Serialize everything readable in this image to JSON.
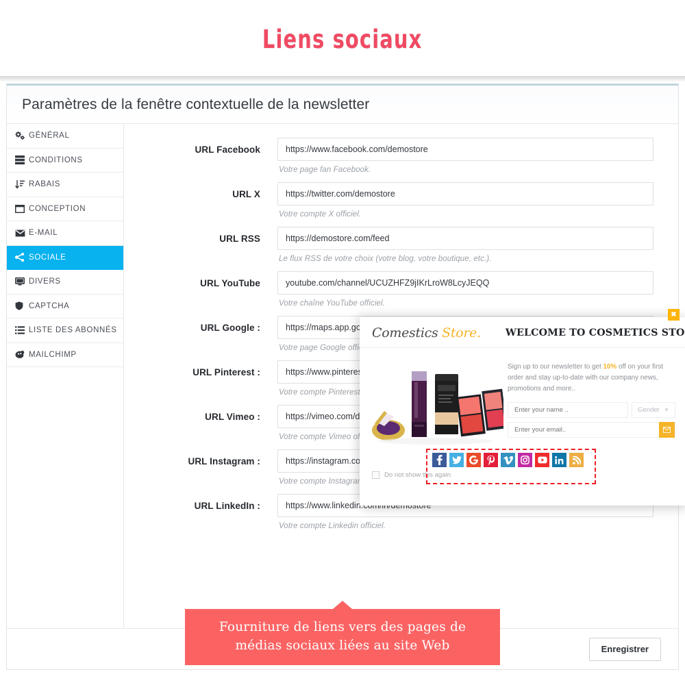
{
  "banner": {
    "title": "Liens sociaux"
  },
  "panel": {
    "header_title": "Paramètres de la fenêtre contextuelle de la newsletter",
    "save_label": "Enregistrer"
  },
  "sidebar": {
    "items": [
      {
        "label": "GÉNÉRAL",
        "icon": "gears-icon",
        "active": false
      },
      {
        "label": "CONDITIONS",
        "icon": "server-icon",
        "active": false
      },
      {
        "label": "RABAIS",
        "icon": "sort-amount-icon",
        "active": false
      },
      {
        "label": "CONCEPTION",
        "icon": "window-icon",
        "active": false
      },
      {
        "label": "E-MAIL",
        "icon": "envelope-icon",
        "active": false
      },
      {
        "label": "SOCIALE",
        "icon": "share-icon",
        "active": true
      },
      {
        "label": "DIVERS",
        "icon": "desktop-icon",
        "active": false
      },
      {
        "label": "CAPTCHA",
        "icon": "shield-icon",
        "active": false
      },
      {
        "label": "LISTE DES ABONNÉS",
        "icon": "list-icon",
        "active": false
      },
      {
        "label": "MAILCHIMP",
        "icon": "mailchimp-icon",
        "active": false
      }
    ]
  },
  "form": {
    "fields": [
      {
        "label": "URL Facebook",
        "value": "https://www.facebook.com/demostore",
        "hint": "Votre page fan Facebook."
      },
      {
        "label": "URL X",
        "value": "https://twitter.com/demostore",
        "hint": "Votre compte X officiel."
      },
      {
        "label": "URL RSS",
        "value": "https://demostore.com/feed",
        "hint": "Le flux RSS de votre choix (votre blog, votre boutique, etc.)."
      },
      {
        "label": "URL YouTube",
        "value": "youtube.com/channel/UCUZHFZ9jIKrLroW8LcyJEQQ",
        "hint": "Votre chaîne YouTube officiel."
      },
      {
        "label": "URL Google :",
        "value": "https://maps.app.goo.gl/",
        "hint": "Votre page Google officielle."
      },
      {
        "label": "URL Pinterest :",
        "value": "https://www.pinterest.com/demostore",
        "hint": "Votre compte Pinterest officiel."
      },
      {
        "label": "URL Vimeo :",
        "value": "https://vimeo.com/demostore",
        "hint": "Votre compte Vimeo officiel."
      },
      {
        "label": "URL Instagram :",
        "value": "https://instagram.com/demostore",
        "hint": "Votre compte Instagram officiel."
      },
      {
        "label": "URL LinkedIn :",
        "value": "https://www.linkedin.com/in/demostore",
        "hint": "Votre compte Linkedin officiel."
      }
    ]
  },
  "popup": {
    "close_label": "✖",
    "logo_first": "Comestics ",
    "logo_second": "Store.",
    "welcome": "WELCOME TO COSMETICS STORE",
    "text_before": "Sign up to our newsletter to get ",
    "text_bold": "10%",
    "text_after": " off on your first order and stay up-to-date with our company news, promotions and more..",
    "name_placeholder": "Enter your name ..",
    "gender_label": "Gender",
    "email_placeholder": "Enter your email..",
    "checkbox_label": "Do not show this again",
    "social": [
      {
        "name": "facebook",
        "color": "#3a5a99",
        "glyph": "f"
      },
      {
        "name": "twitter",
        "color": "#45b0e3",
        "glyph": "t"
      },
      {
        "name": "google",
        "color": "#ea4b2a",
        "glyph": "G"
      },
      {
        "name": "pinterest",
        "color": "#e41f39",
        "glyph": "P"
      },
      {
        "name": "vimeo",
        "color": "#3591c0",
        "glyph": "v"
      },
      {
        "name": "instagram",
        "color": "#c32aa3",
        "glyph": "ig"
      },
      {
        "name": "youtube",
        "color": "#f02c2c",
        "glyph": "yt"
      },
      {
        "name": "linkedin",
        "color": "#0e76a8",
        "glyph": "in"
      },
      {
        "name": "rss",
        "color": "#eeae44",
        "glyph": "rss"
      }
    ]
  },
  "callout": {
    "line1": "Fourniture de liens vers des pages de",
    "line2": "médias sociaux liées au site Web"
  },
  "colors": {
    "accent_pink": "#f04a63",
    "active_blue": "#07b2ef",
    "callout_red": "#fb6363",
    "popup_gold": "#f5b429",
    "highlight_dash": "#ef1d25"
  }
}
